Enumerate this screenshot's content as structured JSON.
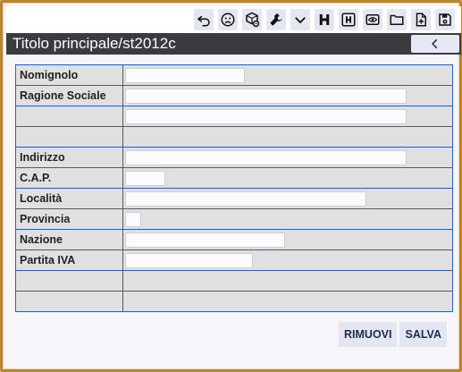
{
  "toolbar": {
    "icons": [
      "undo-icon",
      "sad-face-icon",
      "package-settings-icon",
      "wrench-icon",
      "chevron-down-icon",
      "bold-h-icon",
      "boxed-h-icon",
      "eye-icon",
      "folder-icon",
      "new-file-icon",
      "save-icon"
    ]
  },
  "header": {
    "title": "Titolo principale/st2012c",
    "back_icon": "chevron-left-icon"
  },
  "form": {
    "rows": [
      {
        "label": "Nomignolo",
        "value": ""
      },
      {
        "label": "Ragione Sociale",
        "value": ""
      },
      {
        "label": "",
        "value": ""
      },
      {
        "label": "",
        "value": ""
      },
      {
        "label": "Indirizzo",
        "value": ""
      },
      {
        "label": "C.A.P.",
        "value": ""
      },
      {
        "label": "Località",
        "value": ""
      },
      {
        "label": "Provincia",
        "value": ""
      },
      {
        "label": "Nazione",
        "value": ""
      },
      {
        "label": "Partita IVA",
        "value": ""
      },
      {
        "label": "",
        "value": ""
      },
      {
        "label": "",
        "value": ""
      }
    ]
  },
  "actions": {
    "remove_label": "RIMUOVI",
    "save_label": "SALVA"
  },
  "colors": {
    "frame": "#b8862e",
    "titlebar": "#3b3b3f",
    "grid_line": "#2c5fb6",
    "cell_bg": "#e0e0e0",
    "button_bg": "#e4e6f1"
  }
}
